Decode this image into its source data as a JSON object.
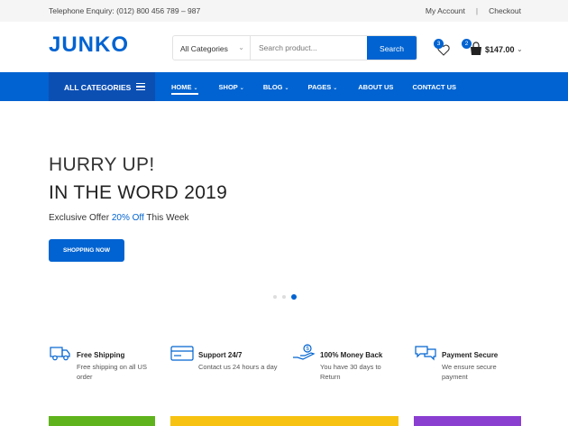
{
  "topbar": {
    "phone": "Telephone Enquiry: (012) 800 456 789 – 987",
    "my_account": "My Account",
    "separator": "|",
    "checkout": "Checkout"
  },
  "header": {
    "logo": "JUNKO",
    "search_category": "All Categories",
    "search_placeholder": "Search product...",
    "search_button": "Search",
    "wishlist_count": "3",
    "cart_count": "2",
    "cart_total": "$147.00"
  },
  "nav": {
    "all_categories": "ALL CATEGORIES",
    "items": [
      {
        "label": "HOME",
        "has_dropdown": true,
        "active": true
      },
      {
        "label": "SHOP",
        "has_dropdown": true
      },
      {
        "label": "BLOG",
        "has_dropdown": true
      },
      {
        "label": "PAGES",
        "has_dropdown": true
      },
      {
        "label": "ABOUT US",
        "has_dropdown": false
      },
      {
        "label": "CONTACT US",
        "has_dropdown": false
      }
    ]
  },
  "hero": {
    "line1": "HURRY UP!",
    "line2": "IN THE WORD 2019",
    "offer_prefix": "Exclusive Offer ",
    "offer_highlight": "20% Off",
    "offer_suffix": " This Week",
    "button": "SHOPPING NOW",
    "slides": 3,
    "active_slide": 3
  },
  "features": [
    {
      "icon": "truck-icon",
      "title": "Free Shipping",
      "desc": "Free shipping on all US order"
    },
    {
      "icon": "credit-card-icon",
      "title": "Support 24/7",
      "desc": "Contact us 24 hours a day"
    },
    {
      "icon": "money-hand-icon",
      "title": "100% Money Back",
      "desc": "You have 30 days to Return"
    },
    {
      "icon": "chat-bubbles-icon",
      "title": "Payment Secure",
      "desc": "We ensure secure payment"
    }
  ],
  "colors": {
    "brand": "#0063d1",
    "nav_dark": "#0b4fb3",
    "banner_green": "#5fb31c",
    "banner_yellow": "#f7c211",
    "banner_purple": "#8a3fd1"
  }
}
